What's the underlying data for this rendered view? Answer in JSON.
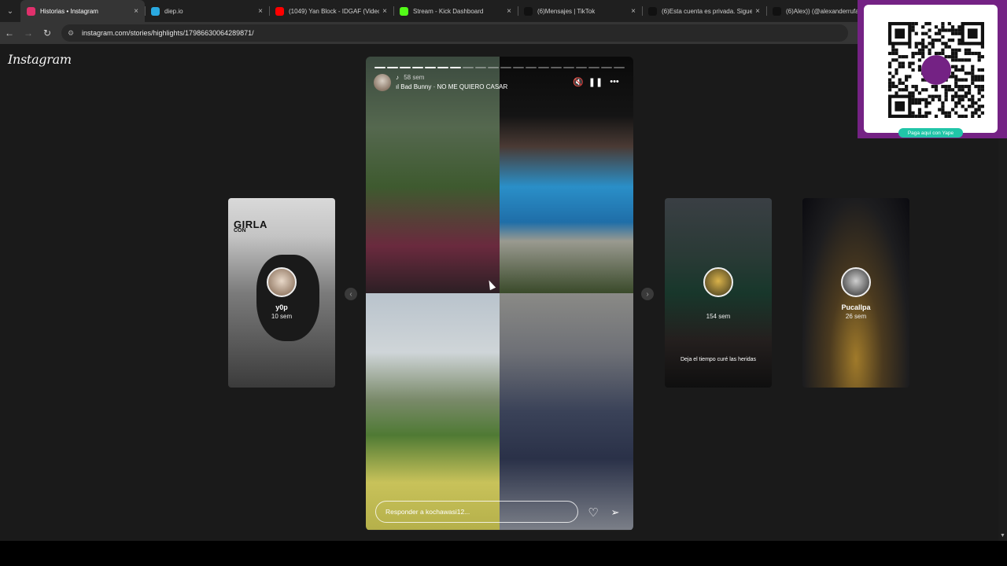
{
  "browser": {
    "tabs": [
      {
        "title": "Historias • Instagram",
        "icon": "instagram-icon",
        "color": "#e1306c",
        "active": true,
        "close": "×"
      },
      {
        "title": "diep.io",
        "icon": "diep-icon",
        "color": "#2aa9e0",
        "active": false,
        "close": "×"
      },
      {
        "title": "(1049) Yan Block - IDGAF (Video",
        "icon": "youtube-icon",
        "color": "#ff0000",
        "active": false,
        "close": "×"
      },
      {
        "title": "Stream - Kick Dashboard",
        "icon": "kick-icon",
        "color": "#53fc18",
        "active": false,
        "close": "×"
      },
      {
        "title": "(6)Mensajes | TikTok",
        "icon": "tiktok-icon",
        "color": "#111111",
        "active": false,
        "close": "×"
      },
      {
        "title": "(6)Esta cuenta es privada. Sigue",
        "icon": "tiktok-icon",
        "color": "#111111",
        "active": false,
        "close": "×"
      },
      {
        "title": "(6)Alex)) (@alexanderrufas",
        "icon": "tiktok-icon",
        "color": "#111111",
        "active": false,
        "close": ""
      }
    ],
    "url": "instagram.com/stories/highlights/17986630064289871/"
  },
  "page": {
    "logo": "Instagram",
    "side_stories": [
      {
        "name": "y0p",
        "time": "10 sem",
        "top_text": "GIRLA",
        "sub_text": "CON"
      },
      {
        "name": "",
        "time": "154 sem",
        "caption": "Deja el tiempo curé las heridas"
      },
      {
        "name": "Pucallpa",
        "time": "26 sem"
      }
    ],
    "story": {
      "time": "58 sem",
      "song": "Bad Bunny · NO ME QUIERO CASAR",
      "reply_placeholder": "Responder a kochawasi12...",
      "segments_total": 20,
      "segments_done": 7
    }
  },
  "overlay": {
    "qr_button": "Paga aquí con Yape",
    "brand_color": "#742284"
  }
}
